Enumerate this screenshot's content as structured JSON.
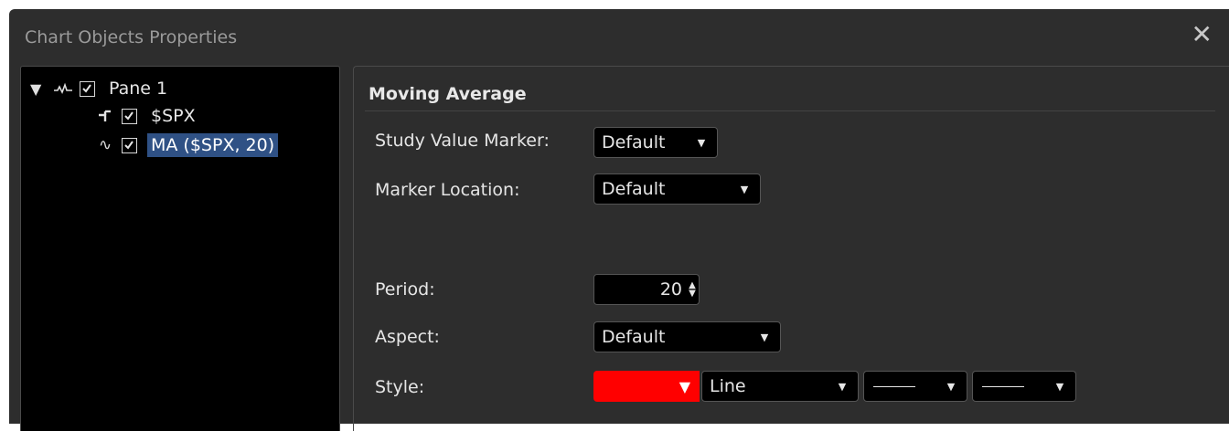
{
  "window": {
    "title": "Chart Objects Properties",
    "close_glyph": "✕"
  },
  "tree": {
    "items": [
      {
        "label": "Pane 1",
        "icon": "pane-wave-icon",
        "checked": true,
        "expanded": true
      },
      {
        "label": "$SPX",
        "icon": "step-line-icon",
        "checked": true
      },
      {
        "label": "MA ($SPX, 20)",
        "icon": "sine-wave-icon",
        "checked": true,
        "selected": true
      }
    ],
    "expander_glyph": "▼",
    "icon_glyphs": {
      "sine": "∿"
    }
  },
  "properties": {
    "section_title": "Moving Average",
    "study_value_marker": {
      "label": "Study Value Marker:",
      "value": "Default"
    },
    "marker_location": {
      "label": "Marker Location:",
      "value": "Default"
    },
    "period": {
      "label": "Period:",
      "value": "20"
    },
    "aspect": {
      "label": "Aspect:",
      "value": "Default"
    },
    "style": {
      "label": "Style:",
      "color": "#ff0000",
      "line_type": "Line"
    }
  },
  "glyphs": {
    "caret": "▼",
    "spin_up": "▲",
    "spin_down": "▼"
  },
  "colors": {
    "dialog_bg": "#2d2d2d",
    "tree_bg": "#000000",
    "selection": "#2f5185",
    "style_color": "#ff0000"
  }
}
